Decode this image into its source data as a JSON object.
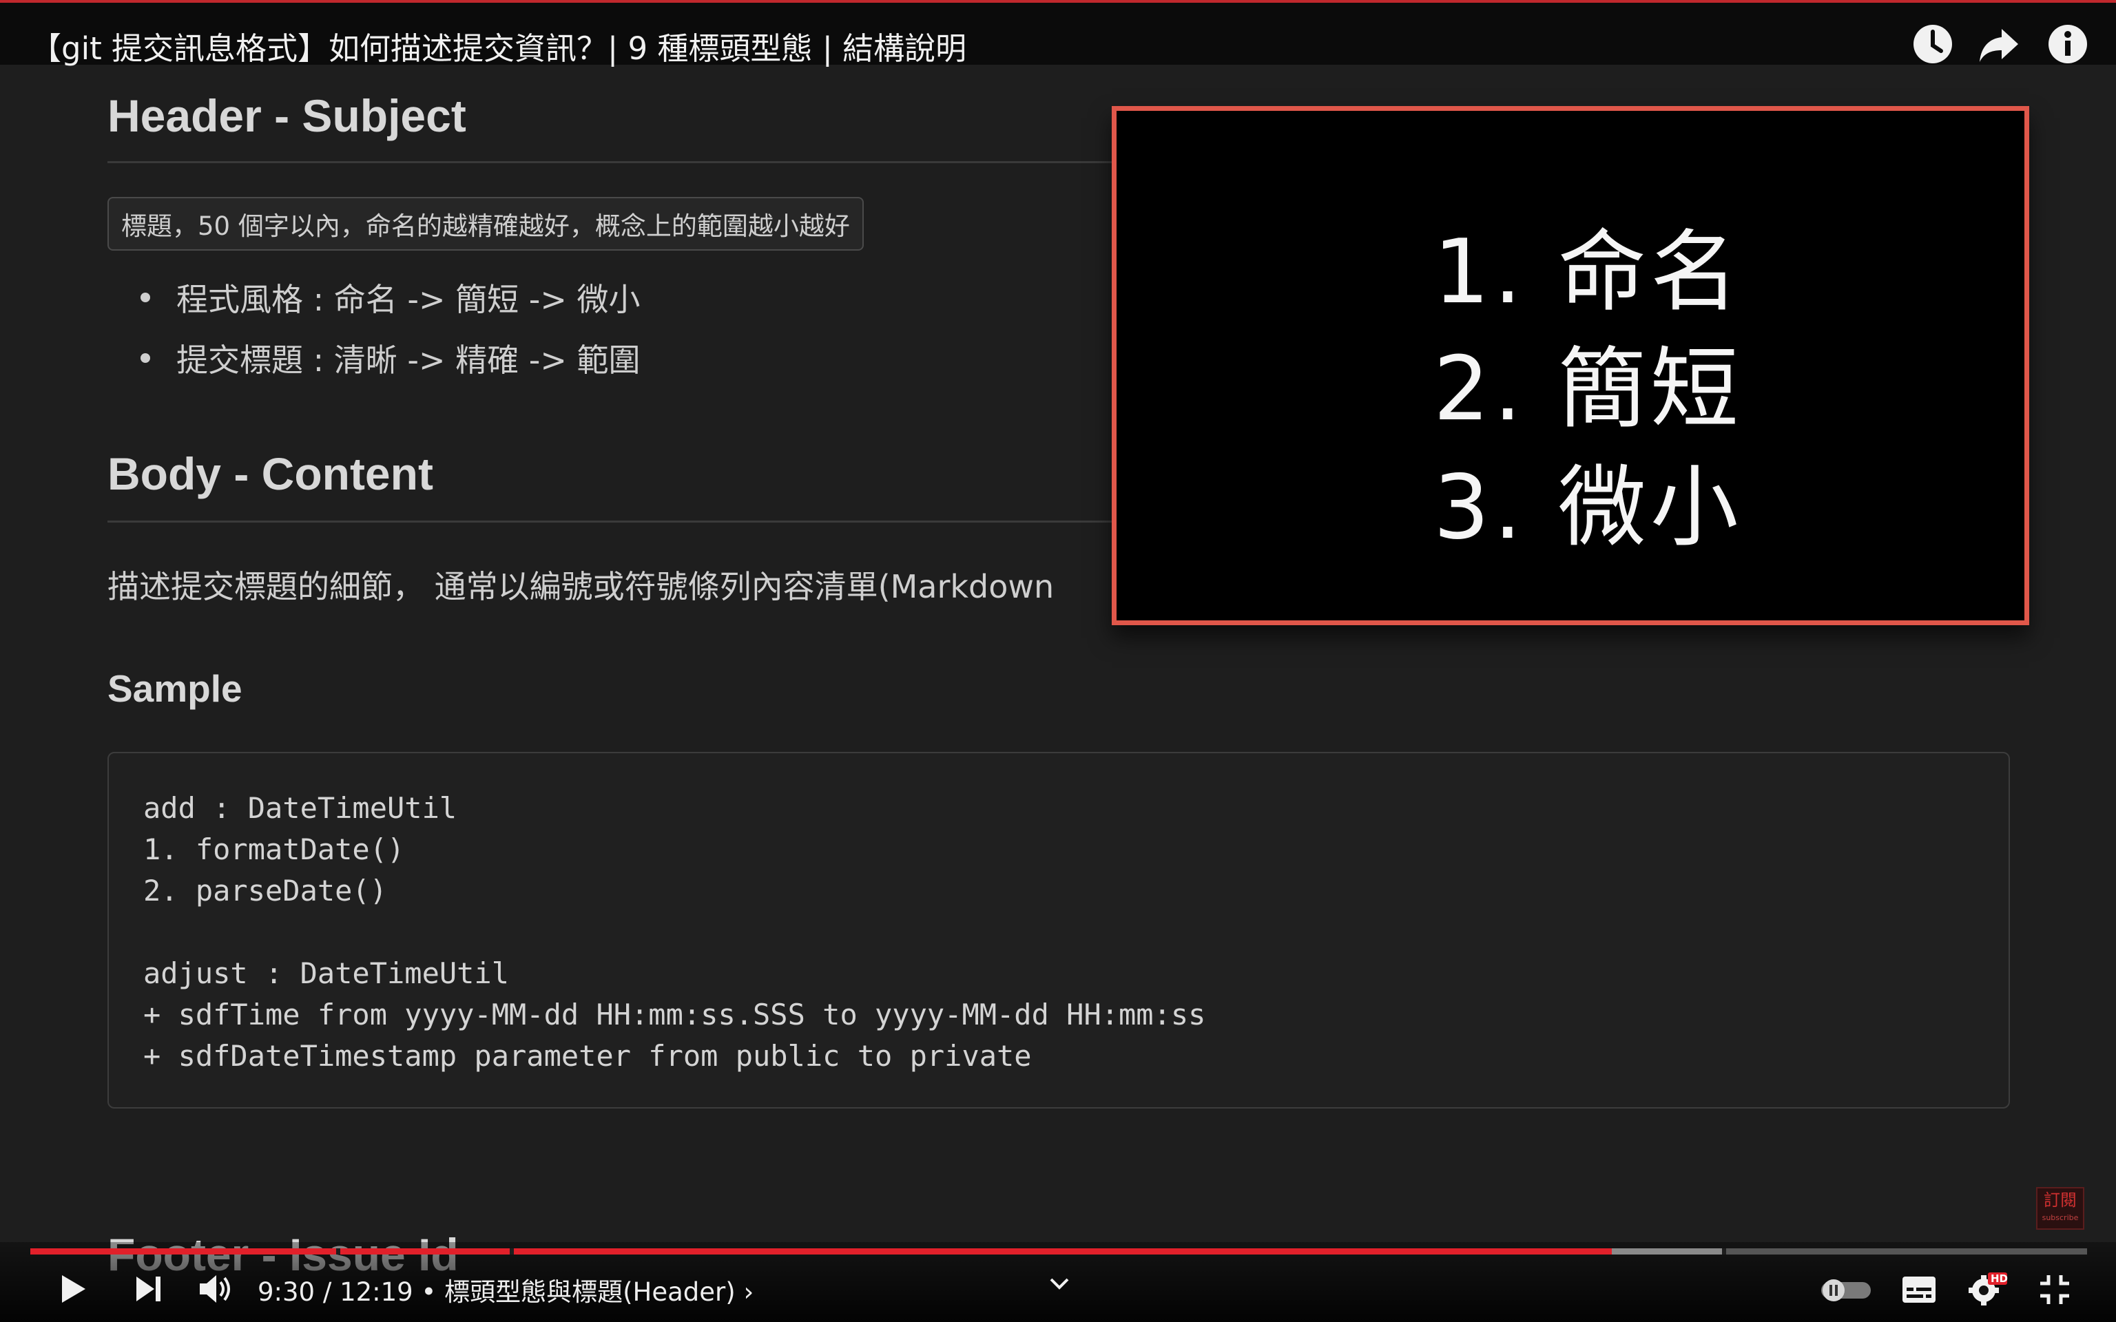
{
  "video_title": "【git 提交訊息格式】如何描述提交資訊？| 9 種標頭型態 | 結構說明",
  "top_icons": [
    "clock-icon",
    "share-icon",
    "info-icon"
  ],
  "doc": {
    "header_subject": "Header - Subject",
    "callout": "標題，50 個字以內，命名的越精確越好，概念上的範圍越小越好",
    "bullets": [
      "程式風格 : 命名 -> 簡短 -> 微小",
      "提交標題 : 清晰 -> 精確 -> 範圍"
    ],
    "body_content": "Body - Content",
    "body_text": "描述提交標題的細節， 通常以編號或符號條列內容清單(Markdown",
    "sample": "Sample",
    "code_lines": [
      "add : DateTimeUtil",
      "1. formatDate()",
      "2. parseDate()",
      "",
      "adjust : DateTimeUtil",
      "+ sdfTime from yyyy-MM-dd HH:mm:ss.SSS to yyyy-MM-dd HH:mm:ss",
      "+ sdfDateTimestamp parameter from public to private"
    ],
    "footer_issue": "Footer - Issue Id"
  },
  "overlay": {
    "items": [
      "1. 命名",
      "2. 簡短",
      "3. 微小"
    ]
  },
  "subscribe": {
    "label": "訂閱",
    "sub": "subscribe"
  },
  "player": {
    "time": "9:30 / 12:19",
    "separator": "•",
    "chapter": "標頭型態與標題(Header)",
    "chapter_arrow": "›",
    "progress_fraction": 0.769,
    "hd_badge": "HD",
    "colors": {
      "progress": "#e1202a",
      "overlay_border": "#e0574a",
      "top_border": "#c0282d"
    }
  }
}
